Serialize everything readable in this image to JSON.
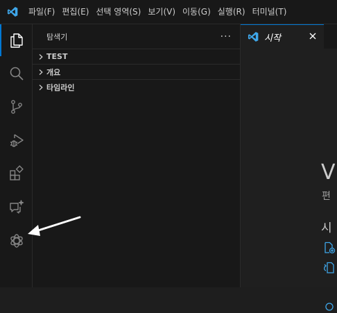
{
  "menubar": {
    "items": [
      "파일(F)",
      "편집(E)",
      "선택 영역(S)",
      "보기(V)",
      "이동(G)",
      "실행(R)",
      "터미널(T)"
    ]
  },
  "activitybar": {
    "items": [
      "explorer-icon",
      "search-icon",
      "source-control-icon",
      "run-debug-icon",
      "extensions-icon",
      "chat-icon",
      "chatgpt-extension-icon"
    ]
  },
  "sidebar": {
    "title": "탐색기",
    "more": "···",
    "sections": [
      {
        "label": "TEST"
      },
      {
        "label": "개요"
      },
      {
        "label": "타임라인"
      }
    ]
  },
  "editor": {
    "tab_label": "시작",
    "welcome_title": "V",
    "welcome_subtitle": "편",
    "start_heading": "시"
  },
  "colors": {
    "accent": "#0078d4",
    "vscode_blue": "#3fa7ea",
    "background": "#1e1e1e",
    "sidebar": "#181818"
  }
}
